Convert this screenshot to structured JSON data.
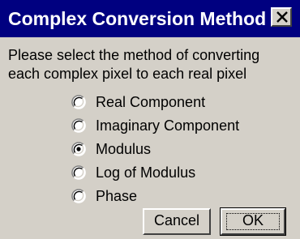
{
  "dialog": {
    "title": "Complex Conversion Method",
    "close_icon": "close-icon",
    "prompt_line1": "Please select the method of converting",
    "prompt_line2": "each complex pixel to each real pixel",
    "options": [
      {
        "label": "Real Component",
        "selected": false
      },
      {
        "label": "Imaginary Component",
        "selected": false
      },
      {
        "label": "Modulus",
        "selected": true
      },
      {
        "label": "Log of Modulus",
        "selected": false
      },
      {
        "label": "Phase",
        "selected": false
      }
    ],
    "cancel_label": "Cancel",
    "ok_label": "OK"
  },
  "colors": {
    "titlebar": "#000080",
    "face": "#d4d0c8",
    "title_text": "#ffffff"
  }
}
